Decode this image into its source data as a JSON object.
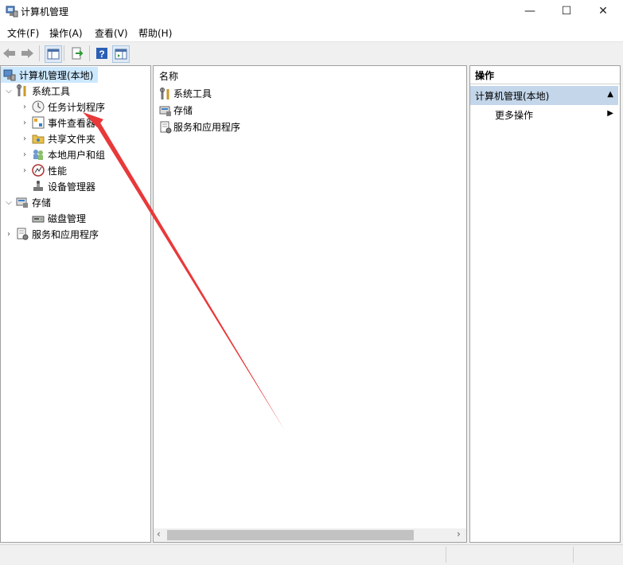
{
  "window": {
    "title": "计算机管理",
    "minimize_glyph": "—",
    "maximize_glyph": "☐",
    "close_glyph": "✕"
  },
  "menu": [
    "文件(F)",
    "操作(A)",
    "查看(V)",
    "帮助(H)"
  ],
  "toolbar": {
    "back_icon": "arrow-left-icon",
    "forward_icon": "arrow-right-icon",
    "buttons": [
      "console-tree-icon",
      "export-icon",
      "help-icon",
      "properties-icon"
    ]
  },
  "tree": {
    "root": "计算机管理(本地)",
    "system_tools": "系统工具",
    "items": [
      "任务计划程序",
      "事件查看器",
      "共享文件夹",
      "本地用户和组",
      "性能",
      "设备管理器"
    ],
    "storage": "存储",
    "disk_management": "磁盘管理",
    "services": "服务和应用程序"
  },
  "list": {
    "column_header": "名称",
    "rows": [
      "系统工具",
      "存储",
      "服务和应用程序"
    ]
  },
  "actions": {
    "header": "操作",
    "section": "计算机管理(本地)",
    "more": "更多操作"
  },
  "colors": {
    "selection": "#cce8ff",
    "section_header": "#c3d6ea",
    "annotation_arrow": "#e8393a"
  }
}
